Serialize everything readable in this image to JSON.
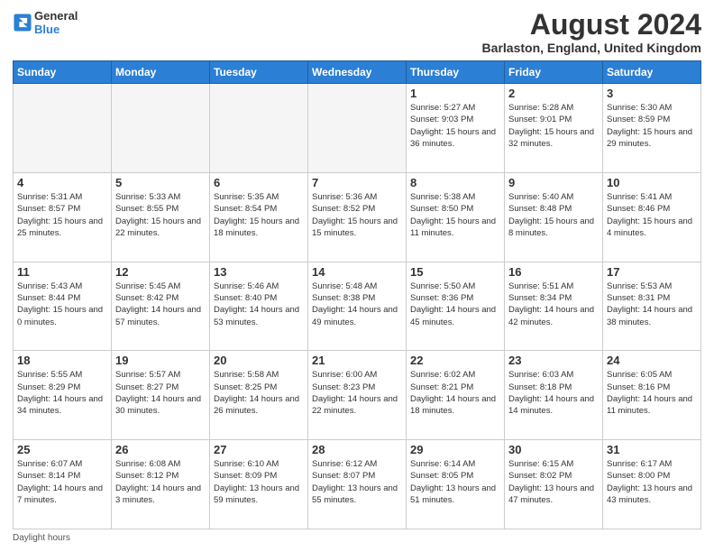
{
  "logo": {
    "line1": "General",
    "line2": "Blue"
  },
  "title": "August 2024",
  "subtitle": "Barlaston, England, United Kingdom",
  "days_header": [
    "Sunday",
    "Monday",
    "Tuesday",
    "Wednesday",
    "Thursday",
    "Friday",
    "Saturday"
  ],
  "footer": "Daylight hours",
  "weeks": [
    [
      {
        "day": "",
        "info": ""
      },
      {
        "day": "",
        "info": ""
      },
      {
        "day": "",
        "info": ""
      },
      {
        "day": "",
        "info": ""
      },
      {
        "day": "1",
        "info": "Sunrise: 5:27 AM\nSunset: 9:03 PM\nDaylight: 15 hours\nand 36 minutes."
      },
      {
        "day": "2",
        "info": "Sunrise: 5:28 AM\nSunset: 9:01 PM\nDaylight: 15 hours\nand 32 minutes."
      },
      {
        "day": "3",
        "info": "Sunrise: 5:30 AM\nSunset: 8:59 PM\nDaylight: 15 hours\nand 29 minutes."
      }
    ],
    [
      {
        "day": "4",
        "info": "Sunrise: 5:31 AM\nSunset: 8:57 PM\nDaylight: 15 hours\nand 25 minutes."
      },
      {
        "day": "5",
        "info": "Sunrise: 5:33 AM\nSunset: 8:55 PM\nDaylight: 15 hours\nand 22 minutes."
      },
      {
        "day": "6",
        "info": "Sunrise: 5:35 AM\nSunset: 8:54 PM\nDaylight: 15 hours\nand 18 minutes."
      },
      {
        "day": "7",
        "info": "Sunrise: 5:36 AM\nSunset: 8:52 PM\nDaylight: 15 hours\nand 15 minutes."
      },
      {
        "day": "8",
        "info": "Sunrise: 5:38 AM\nSunset: 8:50 PM\nDaylight: 15 hours\nand 11 minutes."
      },
      {
        "day": "9",
        "info": "Sunrise: 5:40 AM\nSunset: 8:48 PM\nDaylight: 15 hours\nand 8 minutes."
      },
      {
        "day": "10",
        "info": "Sunrise: 5:41 AM\nSunset: 8:46 PM\nDaylight: 15 hours\nand 4 minutes."
      }
    ],
    [
      {
        "day": "11",
        "info": "Sunrise: 5:43 AM\nSunset: 8:44 PM\nDaylight: 15 hours\nand 0 minutes."
      },
      {
        "day": "12",
        "info": "Sunrise: 5:45 AM\nSunset: 8:42 PM\nDaylight: 14 hours\nand 57 minutes."
      },
      {
        "day": "13",
        "info": "Sunrise: 5:46 AM\nSunset: 8:40 PM\nDaylight: 14 hours\nand 53 minutes."
      },
      {
        "day": "14",
        "info": "Sunrise: 5:48 AM\nSunset: 8:38 PM\nDaylight: 14 hours\nand 49 minutes."
      },
      {
        "day": "15",
        "info": "Sunrise: 5:50 AM\nSunset: 8:36 PM\nDaylight: 14 hours\nand 45 minutes."
      },
      {
        "day": "16",
        "info": "Sunrise: 5:51 AM\nSunset: 8:34 PM\nDaylight: 14 hours\nand 42 minutes."
      },
      {
        "day": "17",
        "info": "Sunrise: 5:53 AM\nSunset: 8:31 PM\nDaylight: 14 hours\nand 38 minutes."
      }
    ],
    [
      {
        "day": "18",
        "info": "Sunrise: 5:55 AM\nSunset: 8:29 PM\nDaylight: 14 hours\nand 34 minutes."
      },
      {
        "day": "19",
        "info": "Sunrise: 5:57 AM\nSunset: 8:27 PM\nDaylight: 14 hours\nand 30 minutes."
      },
      {
        "day": "20",
        "info": "Sunrise: 5:58 AM\nSunset: 8:25 PM\nDaylight: 14 hours\nand 26 minutes."
      },
      {
        "day": "21",
        "info": "Sunrise: 6:00 AM\nSunset: 8:23 PM\nDaylight: 14 hours\nand 22 minutes."
      },
      {
        "day": "22",
        "info": "Sunrise: 6:02 AM\nSunset: 8:21 PM\nDaylight: 14 hours\nand 18 minutes."
      },
      {
        "day": "23",
        "info": "Sunrise: 6:03 AM\nSunset: 8:18 PM\nDaylight: 14 hours\nand 14 minutes."
      },
      {
        "day": "24",
        "info": "Sunrise: 6:05 AM\nSunset: 8:16 PM\nDaylight: 14 hours\nand 11 minutes."
      }
    ],
    [
      {
        "day": "25",
        "info": "Sunrise: 6:07 AM\nSunset: 8:14 PM\nDaylight: 14 hours\nand 7 minutes."
      },
      {
        "day": "26",
        "info": "Sunrise: 6:08 AM\nSunset: 8:12 PM\nDaylight: 14 hours\nand 3 minutes."
      },
      {
        "day": "27",
        "info": "Sunrise: 6:10 AM\nSunset: 8:09 PM\nDaylight: 13 hours\nand 59 minutes."
      },
      {
        "day": "28",
        "info": "Sunrise: 6:12 AM\nSunset: 8:07 PM\nDaylight: 13 hours\nand 55 minutes."
      },
      {
        "day": "29",
        "info": "Sunrise: 6:14 AM\nSunset: 8:05 PM\nDaylight: 13 hours\nand 51 minutes."
      },
      {
        "day": "30",
        "info": "Sunrise: 6:15 AM\nSunset: 8:02 PM\nDaylight: 13 hours\nand 47 minutes."
      },
      {
        "day": "31",
        "info": "Sunrise: 6:17 AM\nSunset: 8:00 PM\nDaylight: 13 hours\nand 43 minutes."
      }
    ]
  ]
}
